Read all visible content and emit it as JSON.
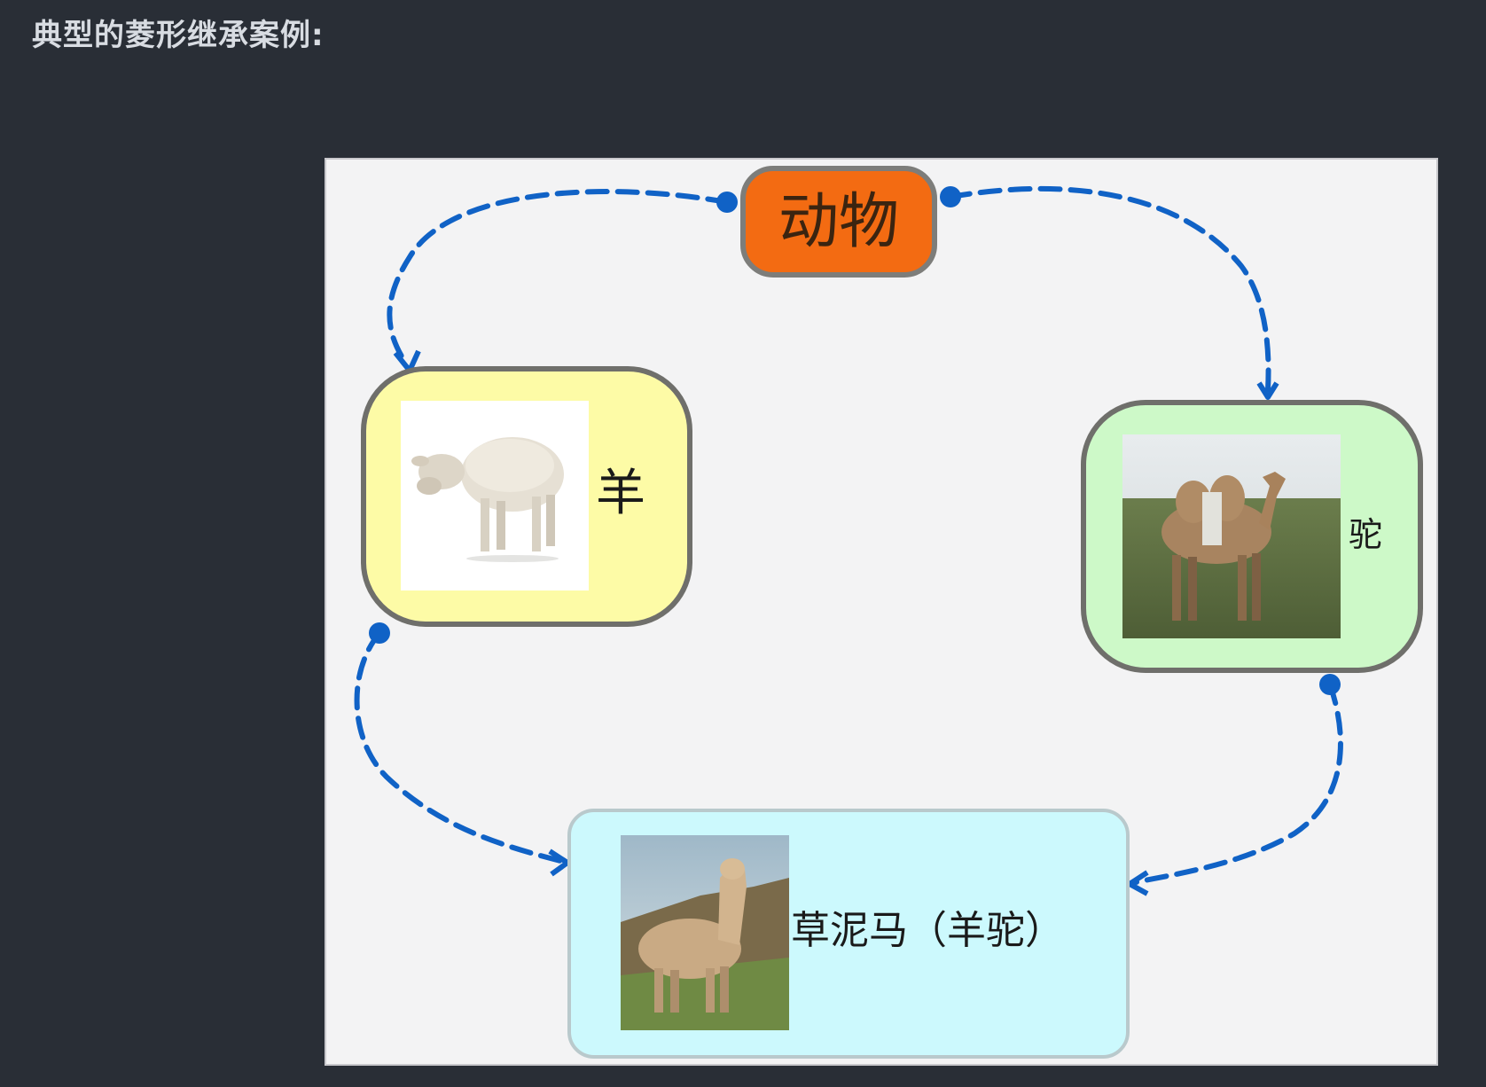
{
  "heading": "典型的菱形继承案例:",
  "diagram": {
    "root": {
      "label": "动物",
      "color": "#f36b12"
    },
    "left": {
      "label": "羊",
      "color": "#fdfba6",
      "image": "sheep"
    },
    "right": {
      "label": "驼",
      "color": "#cdf9c8",
      "image": "camel"
    },
    "bottom": {
      "label": "草泥马（羊驼）",
      "color": "#ccf9fd",
      "image": "alpaca"
    },
    "connector_color": "#1062c6"
  }
}
